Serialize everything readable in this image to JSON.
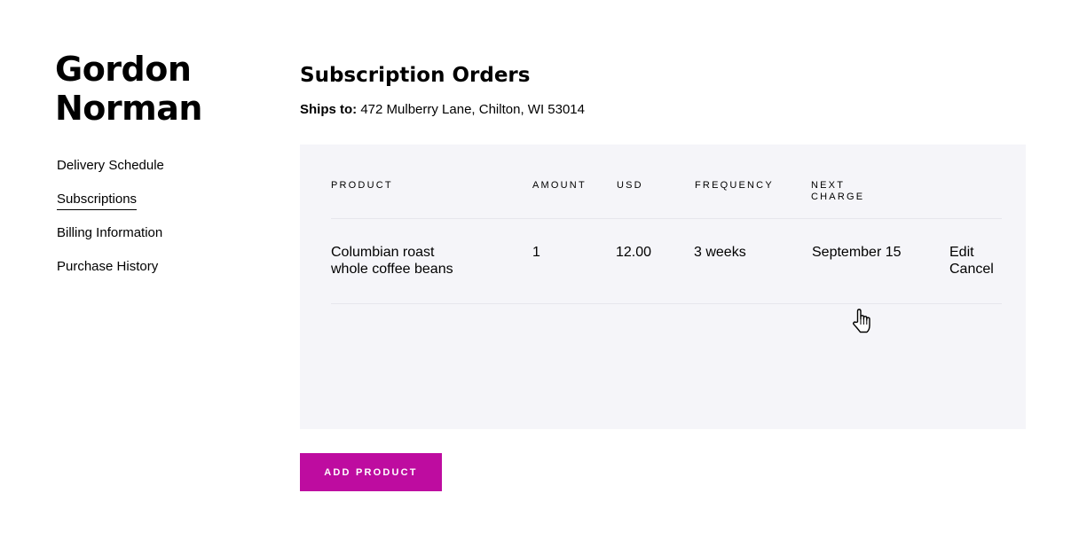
{
  "user": {
    "first_name": "Gordon",
    "last_name": "Norman"
  },
  "sidebar": {
    "items": [
      {
        "label": "Delivery Schedule",
        "active": false
      },
      {
        "label": "Subscriptions",
        "active": true
      },
      {
        "label": "Billing Information",
        "active": false
      },
      {
        "label": "Purchase History",
        "active": false
      }
    ]
  },
  "main": {
    "title": "Subscription Orders",
    "ships_to_label": "Ships to:",
    "ships_to_address": "472 Mulberry Lane, Chilton, WI 53014"
  },
  "table": {
    "headers": {
      "product": "PRODUCT",
      "amount": "AMOUNT",
      "usd": "USD",
      "frequency": "FREQUENCY",
      "next_charge_line1": "NEXT",
      "next_charge_line2": "CHARGE"
    },
    "rows": [
      {
        "product_line1": "Columbian roast",
        "product_line2": "whole coffee beans",
        "amount": "1",
        "usd": "12.00",
        "frequency": "3 weeks",
        "next_charge": "September 15",
        "edit_label": "Edit",
        "cancel_label": "Cancel"
      }
    ]
  },
  "actions": {
    "add_product_label": "ADD PRODUCT"
  },
  "colors": {
    "accent": "#be0ca0",
    "panel_background": "#f5f5f9"
  },
  "icons": {
    "cursor": "hand-pointer-icon"
  }
}
